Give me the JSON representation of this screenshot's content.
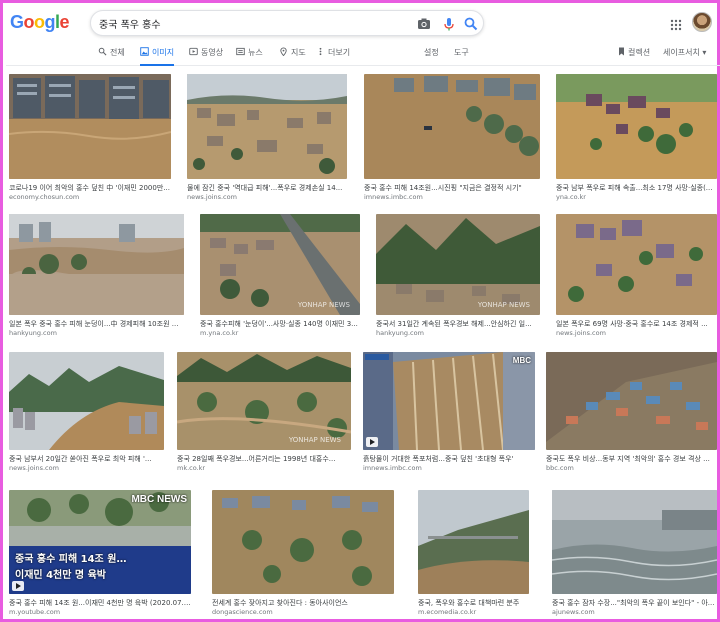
{
  "logo": {
    "text": "Google",
    "letters": [
      "G",
      "o",
      "o",
      "g",
      "l",
      "e"
    ],
    "colors": [
      "#4285f4",
      "#ea4335",
      "#fbbc05",
      "#4285f4",
      "#34a853",
      "#ea4335"
    ]
  },
  "search": {
    "query": "중국 폭우 홍수"
  },
  "tabs": [
    {
      "label": "전체",
      "icon": "search-icon",
      "active": false
    },
    {
      "label": "이미지",
      "icon": "image-icon",
      "active": true
    },
    {
      "label": "동영상",
      "icon": "video-icon",
      "active": false
    },
    {
      "label": "뉴스",
      "icon": "news-icon",
      "active": false
    },
    {
      "label": "지도",
      "icon": "map-pin-icon",
      "active": false
    },
    {
      "label": "더보기",
      "icon": "more-icon",
      "active": false
    }
  ],
  "tools": {
    "settings": "설정",
    "tools": "도구"
  },
  "right_menu": {
    "collections": "컬렉션",
    "safesearch": "세이프서치 ▾"
  },
  "results": [
    {
      "title": "코로나19 이어 최악의 홍수 덮친 中 '이재민 2000만...",
      "source": "economy.chosun.com"
    },
    {
      "title": "물에 잠긴 중국 '역대급 피해'...폭우로 경제손실 14...",
      "source": "news.joins.com"
    },
    {
      "title": "중국 홍수 피해 14조원...시진핑 \"지금은 결정적 시기\"",
      "source": "imnews.imbc.com"
    },
    {
      "title": "중국 남부 폭우로 피해 속출...최소 17명 사망·실종(...",
      "source": "yna.co.kr"
    },
    {
      "title": "일본 폭우 중국 홍수 피해 눈덩이...中 경제피해 10조원 ...",
      "source": "hankyung.com"
    },
    {
      "title": "중국 홍수피해 '눈덩이'...사망·실종 140명 이재민 3...",
      "source": "m.yna.co.kr"
    },
    {
      "title": "중국서 31일간 계속된 폭우경보 해제...안심하긴 일...",
      "source": "hankyung.com"
    },
    {
      "title": "일본 폭우로 69명 사망·중국 홍수로 14조 경제적 ...",
      "source": "news.joins.com"
    },
    {
      "title": "중국 남부서 20일간 쏟아진 폭우로 최악 피해 '...",
      "source": "news.joins.com"
    },
    {
      "title": "중국 28일째 폭우경보...어른거리는 1998년 대홍수...",
      "source": "mk.co.kr"
    },
    {
      "title": "흙탕물이 거대한 폭포처럼...중국 덮친 '초대형 폭우'",
      "source": "imnews.imbc.com"
    },
    {
      "title": "중국도 폭우 비상...동부 지역 '최악의' 홍수 경보 격상 ...",
      "source": "bbc.com"
    },
    {
      "title": "중국 홍수 피해 14조 원...이재민 4천만 명 육박 (2020.07.13...",
      "source": "m.youtube.com"
    },
    {
      "title": "전세계 홍수 잦아지고 찾아진다 : 동아사이언스",
      "source": "dongascience.com"
    },
    {
      "title": "중국, 폭우와 홍수로 대책마련 분주",
      "source": "m.ecomedia.co.kr"
    },
    {
      "title": "중국 홍수 잠자 수장...\"최악의 폭우 끝이 보인다\" - 아...",
      "source": "ajunews.com"
    }
  ],
  "overlays": {
    "r12_line1": "중국 홍수 피해 14조 원…",
    "r12_line2": "이재민 4천만 명 육박",
    "r12_logo": "MBC NEWS",
    "r10_logo": "MBC",
    "yonhap": "YONHAP NEWS"
  }
}
